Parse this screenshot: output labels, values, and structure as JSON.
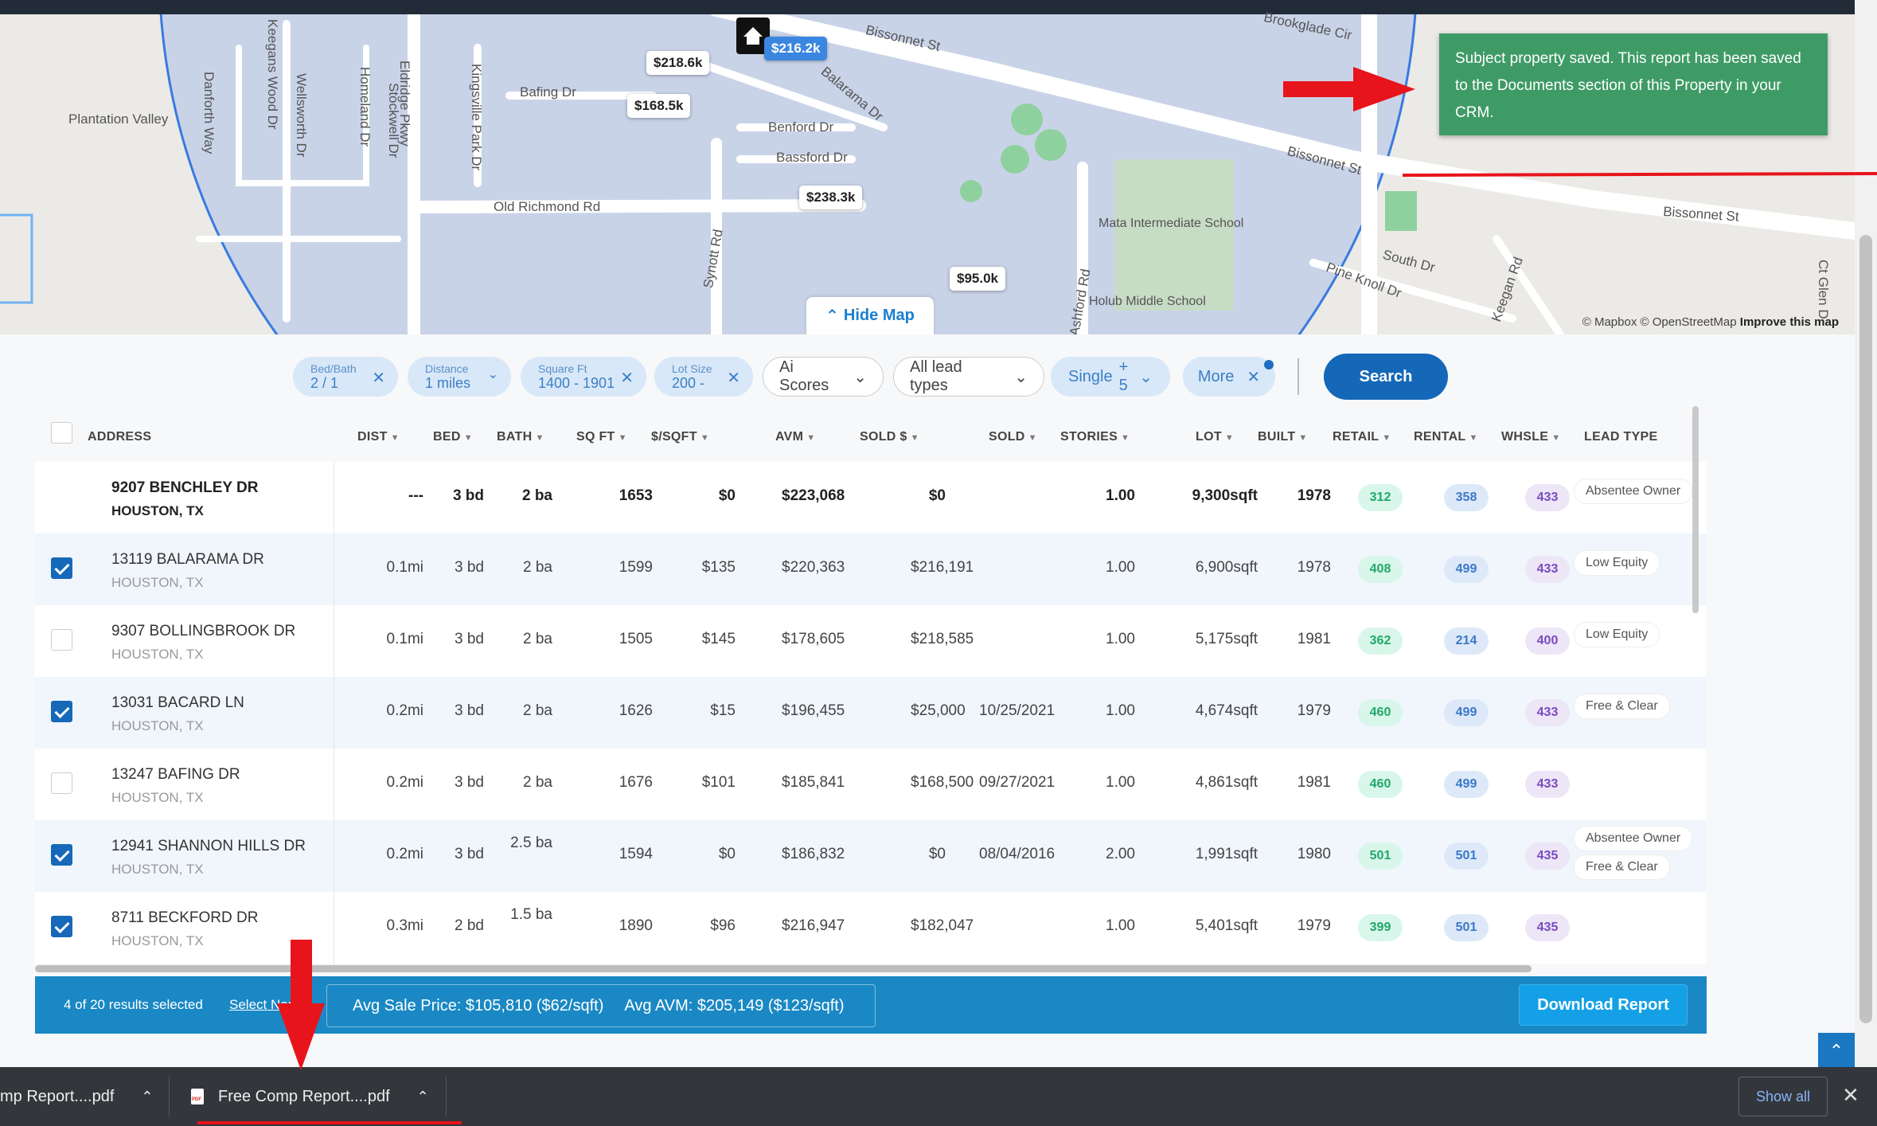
{
  "map": {
    "streets": [
      "Bissonnet St",
      "Bissonnet St",
      "Bissonnet St",
      "Balarama Dr",
      "Benford Dr",
      "Bassford Dr",
      "Bafing Dr",
      "Old Richmond Rd",
      "Synott Rd",
      "Ashford Rd",
      "Eldridge Pkwy",
      "Kingsville Park Dr",
      "Stockwell Dr",
      "Homeland Dr",
      "Wellsworth Dr",
      "Keegans Wood Dr",
      "Danforth Way",
      "Plantation Valley",
      "South Dr",
      "Pine Knoll Dr",
      "Keegan Rd",
      "Brookglade Cir",
      "Ct Glen D"
    ],
    "places": [
      "Mata Intermediate School",
      "Holub Middle School"
    ],
    "pins": [
      "$216.2k",
      "$218.6k",
      "$168.5k",
      "$238.3k",
      "$95.0k"
    ],
    "hide_label": "Hide Map",
    "attribution": "© Mapbox © OpenStreetMap",
    "improve": "Improve this map"
  },
  "toast": {
    "text": "Subject property saved. This report has been saved to the Documents section of this Property in your CRM."
  },
  "filters": {
    "bedbath": {
      "label": "Bed/Bath",
      "value": "2 / 1"
    },
    "distance": {
      "label": "Distance",
      "value": "1 miles"
    },
    "sqft": {
      "label": "Square Ft",
      "value": "1400 - 1901"
    },
    "lotsize": {
      "label": "Lot Size",
      "value": "200 -"
    },
    "ai_scores": "Ai Scores",
    "lead_types": "All lead types",
    "single": "Single",
    "single_more": "+ 5",
    "more": "More",
    "search": "Search"
  },
  "table": {
    "headers": [
      "ADDRESS",
      "DIST",
      "BED",
      "BATH",
      "SQ FT",
      "$/SQFT",
      "AVM",
      "SOLD $",
      "SOLD",
      "STORIES",
      "LOT",
      "BUILT",
      "RETAIL",
      "RENTAL",
      "WHSLE",
      "LEAD TYPE"
    ],
    "rows": [
      {
        "street": "9207 BENCHLEY DR",
        "city": "HOUSTON, TX",
        "dist": "---",
        "bed": "3 bd",
        "bath": "2 ba",
        "sqft": "1653",
        "psf": "$0",
        "avm": "$223,068",
        "sold_price": "$0",
        "sold_date": "",
        "stories": "1.00",
        "lot": "9,300sqft",
        "built": "1978",
        "retail": "312",
        "rental": "358",
        "whsle": "433",
        "lead": [
          "Absentee Owner"
        ],
        "checked": null
      },
      {
        "street": "13119 BALARAMA DR",
        "city": "HOUSTON, TX",
        "dist": "0.1mi",
        "bed": "3 bd",
        "bath": "2 ba",
        "sqft": "1599",
        "psf": "$135",
        "avm": "$220,363",
        "sold_price": "$216,191",
        "sold_date": "",
        "stories": "1.00",
        "lot": "6,900sqft",
        "built": "1978",
        "retail": "408",
        "rental": "499",
        "whsle": "433",
        "lead": [
          "Low Equity"
        ],
        "checked": true
      },
      {
        "street": "9307 BOLLINGBROOK DR",
        "city": "HOUSTON, TX",
        "dist": "0.1mi",
        "bed": "3 bd",
        "bath": "2 ba",
        "sqft": "1505",
        "psf": "$145",
        "avm": "$178,605",
        "sold_price": "$218,585",
        "sold_date": "",
        "stories": "1.00",
        "lot": "5,175sqft",
        "built": "1981",
        "retail": "362",
        "rental": "214",
        "whsle": "400",
        "lead": [
          "Low Equity"
        ],
        "checked": false
      },
      {
        "street": "13031 BACARD LN",
        "city": "HOUSTON, TX",
        "dist": "0.2mi",
        "bed": "3 bd",
        "bath": "2 ba",
        "sqft": "1626",
        "psf": "$15",
        "avm": "$196,455",
        "sold_price": "$25,000",
        "sold_date": "10/25/2021",
        "stories": "1.00",
        "lot": "4,674sqft",
        "built": "1979",
        "retail": "460",
        "rental": "499",
        "whsle": "433",
        "lead": [
          "Free & Clear"
        ],
        "checked": true
      },
      {
        "street": "13247 BAFING DR",
        "city": "HOUSTON, TX",
        "dist": "0.2mi",
        "bed": "3 bd",
        "bath": "2 ba",
        "sqft": "1676",
        "psf": "$101",
        "avm": "$185,841",
        "sold_price": "$168,500",
        "sold_date": "09/27/2021",
        "stories": "1.00",
        "lot": "4,861sqft",
        "built": "1981",
        "retail": "460",
        "rental": "499",
        "whsle": "433",
        "lead": [],
        "checked": false
      },
      {
        "street": "12941 SHANNON HILLS DR",
        "city": "HOUSTON, TX",
        "dist": "0.2mi",
        "bed": "3 bd",
        "bath": "2.5 ba",
        "sqft": "1594",
        "psf": "$0",
        "avm": "$186,832",
        "sold_price": "$0",
        "sold_date": "08/04/2016",
        "stories": "2.00",
        "lot": "1,991sqft",
        "built": "1980",
        "retail": "501",
        "rental": "501",
        "whsle": "435",
        "lead": [
          "Absentee Owner",
          "Free & Clear"
        ],
        "checked": true
      },
      {
        "street": "8711 BECKFORD DR",
        "city": "HOUSTON, TX",
        "dist": "0.3mi",
        "bed": "2 bd",
        "bath": "1.5 ba",
        "sqft": "1890",
        "psf": "$96",
        "avm": "$216,947",
        "sold_price": "$182,047",
        "sold_date": "",
        "stories": "1.00",
        "lot": "5,401sqft",
        "built": "1979",
        "retail": "399",
        "rental": "501",
        "whsle": "435",
        "lead": [],
        "checked": true
      }
    ]
  },
  "summary": {
    "count": "4 of 20 results selected",
    "select_none": "Select None",
    "avg_sale": "Avg Sale Price: $105,810 ($62/sqft)",
    "avg_avm": "Avg AVM: $205,149 ($123/sqft)",
    "download": "Download Report"
  },
  "shelf": {
    "item1": "mp Report....pdf",
    "item2": "Free Comp Report....pdf",
    "show_all": "Show all"
  },
  "colors": {
    "accent": "#1568b8",
    "toast": "#3f9b66",
    "summary": "#1a88c4",
    "annotation": "#e8141b"
  }
}
